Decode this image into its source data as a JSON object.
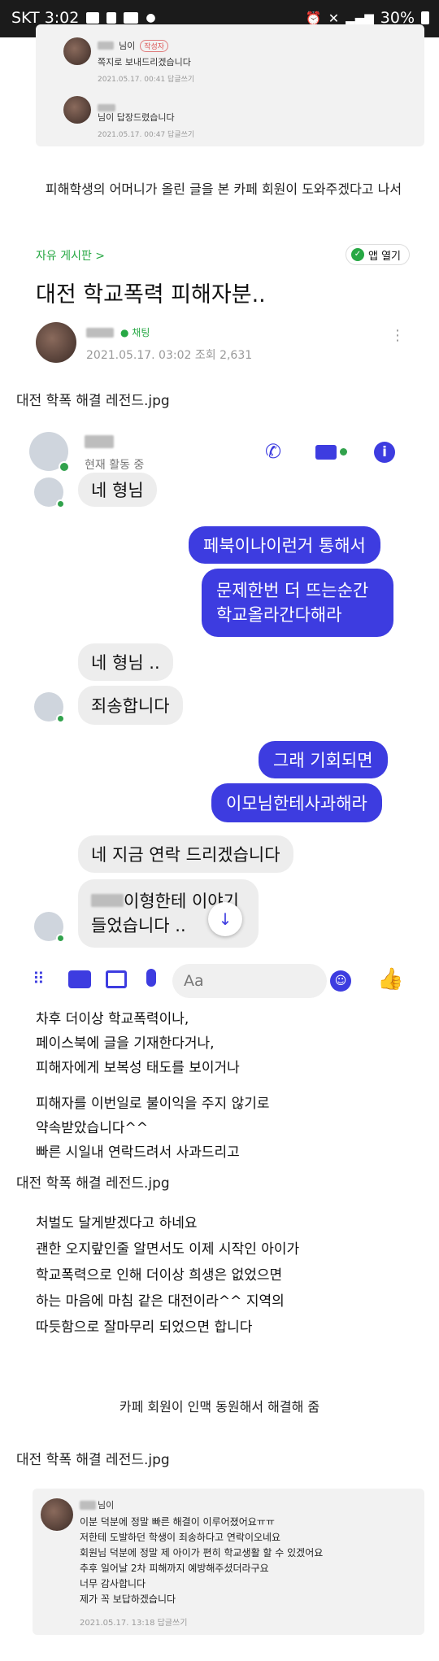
{
  "statusbar": {
    "carrier_time": "SKT 3:02",
    "battery": "30%"
  },
  "comments_top": [
    {
      "name_suffix": "님이",
      "badge": "작성자",
      "text": "쪽지로 보내드리겠습니다",
      "meta": "2021.05.17. 00:41   답글쓰기"
    },
    {
      "name_suffix": "님이 답장드렸습니다",
      "badge": "",
      "text": "",
      "meta": "2021.05.17. 00:47   답글쓰기"
    }
  ],
  "caption_main": "피해학생의 어머니가 올린 글을 본 카페 회원이 도와주겠다고 나서",
  "post": {
    "board": "자유 게시판 >",
    "app_open": "앱 열기",
    "title": "대전 학교폭력 피해자분..",
    "chat": "채팅",
    "meta": "2021.05.17. 03:02  조회 2,631"
  },
  "img_caption_1": "대전 학폭 해결 레전드.jpg",
  "messenger": {
    "status": "현재 활동 중",
    "messages": [
      {
        "dir": "in",
        "text": "네 형님"
      },
      {
        "dir": "out",
        "text": "페북이나이런거 통해서"
      },
      {
        "dir": "out",
        "text": "문제한번 더 뜨는순간"
      },
      {
        "dir": "out",
        "text": "학교올라간다해라"
      },
      {
        "dir": "in",
        "text": "네 형님 .."
      },
      {
        "dir": "in",
        "text": "죄송합니다"
      },
      {
        "dir": "out",
        "text": "그래 기회되면"
      },
      {
        "dir": "out",
        "text": "이모님한테사과해라"
      },
      {
        "dir": "in",
        "text": "네 지금 연락 드리겠습니다"
      },
      {
        "dir": "in",
        "text": "이형한테 이야기"
      },
      {
        "dir": "in",
        "text": "들었습니다 .."
      }
    ],
    "compose_placeholder": "Aa"
  },
  "text_block_1": [
    "차후 더이상 학교폭력이나,",
    "페이스북에 글을 기재한다거나,",
    "피해자에게  보복성 태도를 보이거나",
    "피해자를 이번일로 불이익을 주지 않기로",
    "약속받았습니다^^",
    "빠른 시일내 연락드려서 사과드리고"
  ],
  "img_caption_2": "대전 학폭 해결 레전드.jpg",
  "text_block_2": [
    "처벌도 달게받겠다고 하네요",
    "괜한 오지랖인줄 알면서도 이제 시작인 아이가",
    "학교폭력으로 인해 더이상 희생은 없었으면",
    "하는 마음에 마침 같은 대전이라^^ 지역의",
    "따듯함으로 잘마무리 되었으면 합니다"
  ],
  "caption_2": "카페 회원이 인맥 동원해서 해결해 줌",
  "img_caption_3": "대전 학폭 해결 레전드.jpg",
  "comment_bottom": {
    "name_suffix": "님이",
    "lines": [
      "이분 덕분에 정말 빠른 해결이 이루어졌어요ㅠㅠ",
      "저한테 도발하던 학생이 죄송하다고 연락이오네요",
      "회원님 덕분에 정말 제 아이가 편히 학교생활 할 수 있겠어요",
      "추후 일어날 2차 피해까지 예방해주셨더라구요",
      "너무 감사합니다",
      "제가 꼭 보답하겠습니다"
    ],
    "meta": "2021.05.17. 13:18   답글쓰기"
  },
  "colors": {
    "accent": "#3d3ce0",
    "green": "#31a24c",
    "messenger_blue": "#2f54eb"
  }
}
